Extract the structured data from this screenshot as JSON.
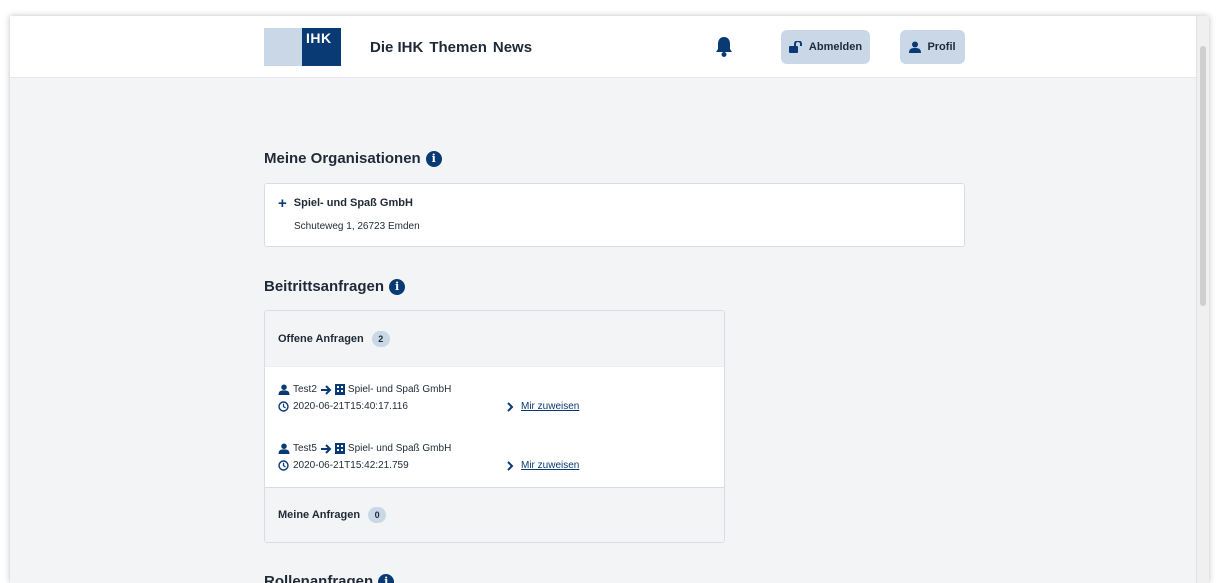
{
  "header": {
    "logo_text": "IHK",
    "nav": [
      "Die IHK",
      "Themen",
      "News"
    ],
    "logout_label": "Abmelden",
    "profile_label": "Profil"
  },
  "organizations": {
    "title": "Meine Organisationen",
    "items": [
      {
        "name": "Spiel- und Spaß GmbH",
        "address": "Schuteweg 1, 26723 Emden"
      }
    ]
  },
  "join_requests": {
    "title": "Beitrittsanfragen",
    "open": {
      "label": "Offene Anfragen",
      "count": "2",
      "items": [
        {
          "user": "Test2",
          "org": "Spiel- und Spaß GmbH",
          "timestamp": "2020-06-21T15:40:17.116",
          "action": "Mir zuweisen"
        },
        {
          "user": "Test5",
          "org": "Spiel- und Spaß GmbH",
          "timestamp": "2020-06-21T15:42:21.759",
          "action": "Mir zuweisen"
        }
      ]
    },
    "mine": {
      "label": "Meine Anfragen",
      "count": "0"
    }
  },
  "role_requests": {
    "title": "Rollenanfragen"
  },
  "colors": {
    "brand": "#0a3a73",
    "button_bg": "#c9d7e6",
    "page_bg": "#f3f4f6"
  },
  "icons": [
    "bell-icon",
    "unlock-icon",
    "user-icon",
    "info-icon",
    "plus-icon",
    "arrow-right-icon",
    "building-icon",
    "clock-icon",
    "chevron-right-icon"
  ]
}
